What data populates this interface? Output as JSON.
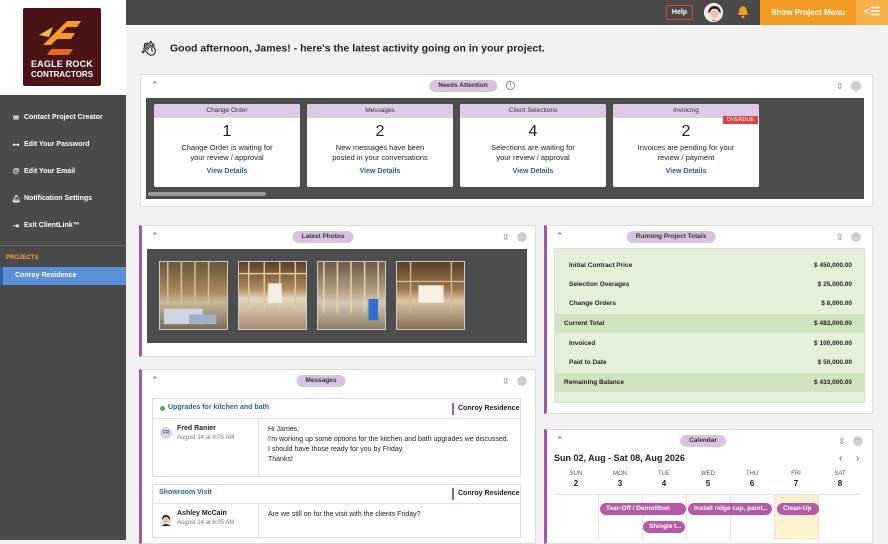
{
  "sidebar": {
    "logo": {
      "line1": "EAGLE ROCK",
      "line2": "CONTRACTORS"
    },
    "items": [
      {
        "label": "Contact Project Creator",
        "icon": "envelope-icon"
      },
      {
        "label": "Edit Your Password",
        "icon": "key-icon"
      },
      {
        "label": "Edit Your Email",
        "icon": "at-icon"
      },
      {
        "label": "Notification Settings",
        "icon": "bell-icon"
      },
      {
        "label": "Exit ClientLink™",
        "icon": "exit-icon"
      }
    ],
    "projects_label": "PROJECTS",
    "project": "Conroy Residence"
  },
  "topbar": {
    "help": "Help",
    "show_menu": "Show Project Menu",
    "menu_icon": "<☰"
  },
  "greeting": "Good afternoon, James! - here's the latest activity going on in your project.",
  "needs_attention": {
    "title": "Needs Attention",
    "cards": [
      {
        "header": "Change Order",
        "count": "1",
        "line1": "Change Order is waiting for",
        "line2": "your review / approval",
        "link": "View Details"
      },
      {
        "header": "Messages",
        "count": "2",
        "line1": "New messages have been",
        "line2": "posted in your conversations",
        "link": "View Details"
      },
      {
        "header": "Client Selections",
        "count": "4",
        "line1": "Selections are waiting for",
        "line2": "your review / approval",
        "link": "View Details"
      },
      {
        "header": "Invoicing",
        "count": "2",
        "line1": "Invoices are pending for your",
        "line2": "review / payment",
        "link": "View Details",
        "badge": "OVERDUE"
      }
    ]
  },
  "latest_photos": {
    "title": "Latest Photos"
  },
  "running_totals": {
    "title": "Running Project Totals",
    "rows": [
      {
        "label": "Initial Contract Price",
        "value": "$ 450,000.00"
      },
      {
        "label": "Selection Overages",
        "value": "$ 25,000.00"
      },
      {
        "label": "Change Orders",
        "value": "$ 8,000.00"
      },
      {
        "label": "Current Total",
        "value": "$ 483,000.00"
      },
      {
        "label": "Invoiced",
        "value": "$ 100,000.00"
      },
      {
        "label": "Paid to Date",
        "value": "$ 50,000.00"
      },
      {
        "label": "Remaining Balance",
        "value": "$ 433,000.00"
      }
    ]
  },
  "messages": {
    "title": "Messages",
    "threads": [
      {
        "subject": "Upgrades for kitchen and bath",
        "project": "Conroy Residence",
        "initials": "FR",
        "from": "Fred Ranier",
        "date": "August 14 at 9:05 AM",
        "body": [
          "Hi James,",
          "I'm working up some options for the kitchen and bath upgrades we discussed.",
          "I should have those ready for you by Friday.",
          "Thanks!"
        ]
      },
      {
        "subject": "Showroom Visit",
        "project": "Conroy Residence",
        "from": "Ashley McCain",
        "date": "August 14 at 6:05 AM",
        "body": [
          "Are we still on for the visit with the clients Friday?"
        ]
      }
    ]
  },
  "calendar": {
    "title": "Calendar",
    "range": "Sun 02, Aug - Sat 08, Aug 2026",
    "prev": "‹",
    "next": "›",
    "days": [
      {
        "name": "SUN",
        "num": "2"
      },
      {
        "name": "MON",
        "num": "3"
      },
      {
        "name": "TUE",
        "num": "4"
      },
      {
        "name": "WED",
        "num": "5"
      },
      {
        "name": "THU",
        "num": "6"
      },
      {
        "name": "FRI",
        "num": "7"
      },
      {
        "name": "SAT",
        "num": "8"
      }
    ],
    "events": [
      "Tear-Off / Demolition",
      "Install ridge cap, paint...",
      "Clean-Up",
      "Shingle I..."
    ]
  },
  "colors": {
    "accent": "#f39c24",
    "purple": "#9e5aa8",
    "link": "#2563a8",
    "overdue": "#d64545"
  }
}
